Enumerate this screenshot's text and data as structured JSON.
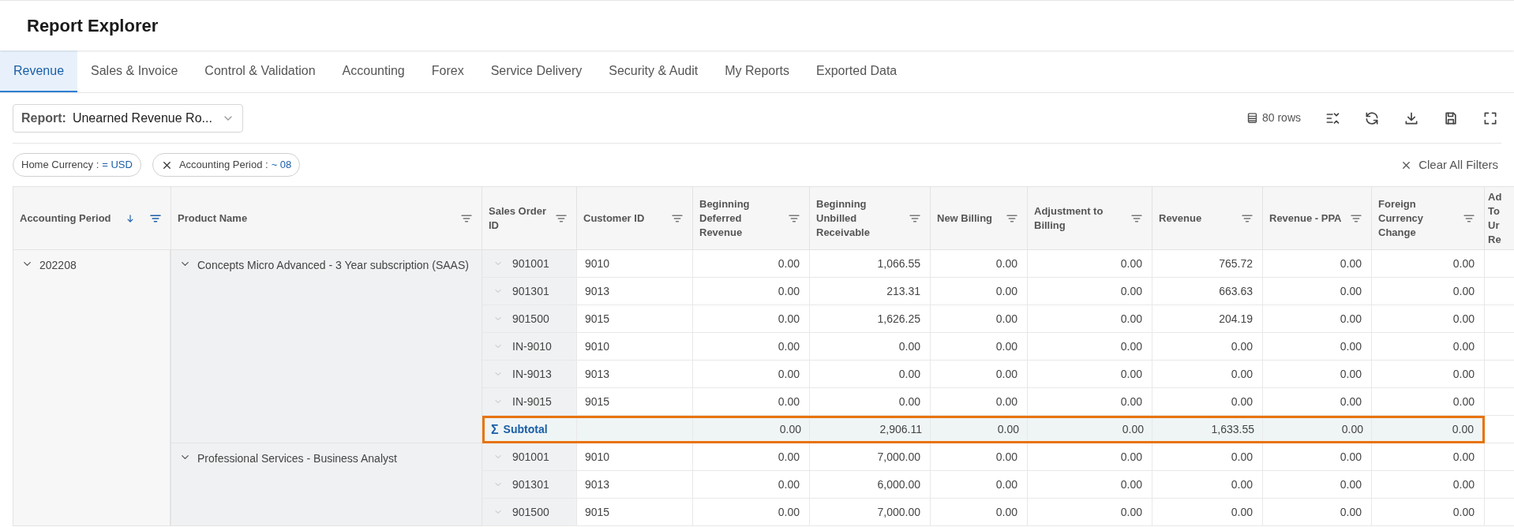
{
  "window": {
    "title": "Report Explorer"
  },
  "tabs": [
    {
      "label": "Revenue",
      "selected": true
    },
    {
      "label": "Sales & Invoice",
      "selected": false
    },
    {
      "label": "Control & Validation",
      "selected": false
    },
    {
      "label": "Accounting",
      "selected": false
    },
    {
      "label": "Forex",
      "selected": false
    },
    {
      "label": "Service Delivery",
      "selected": false
    },
    {
      "label": "Security & Audit",
      "selected": false
    },
    {
      "label": "My Reports",
      "selected": false
    },
    {
      "label": "Exported Data",
      "selected": false
    }
  ],
  "toolbar": {
    "report_label": "Report:",
    "report_value": "Unearned Revenue Ro...",
    "row_count": "80 rows"
  },
  "filters": [
    {
      "field": "Home Currency :",
      "value": "= USD",
      "removable": false
    },
    {
      "field": "Accounting Period :",
      "value": "~ 08",
      "removable": true
    }
  ],
  "clear_filters": "Clear All Filters",
  "table": {
    "columns": [
      {
        "label": "Accounting Period",
        "sorted": true,
        "filter_active": true
      },
      {
        "label": "Product Name",
        "sorted": false,
        "filter_active": false
      },
      {
        "label": "Sales Order ID",
        "sorted": false,
        "filter_active": false
      },
      {
        "label": "Customer ID",
        "sorted": false,
        "filter_active": false
      },
      {
        "label": "Beginning Deferred Revenue",
        "sorted": false,
        "filter_active": false
      },
      {
        "label": "Beginning Unbilled Receivable",
        "sorted": false,
        "filter_active": false
      },
      {
        "label": "New Billing",
        "sorted": false,
        "filter_active": false
      },
      {
        "label": "Adjustment to Billing",
        "sorted": false,
        "filter_active": false
      },
      {
        "label": "Revenue",
        "sorted": false,
        "filter_active": false
      },
      {
        "label": "Revenue - PPA",
        "sorted": false,
        "filter_active": false
      },
      {
        "label": "Foreign Currency Change",
        "sorted": false,
        "filter_active": false
      },
      {
        "label": "Ad To Ur Re"
      }
    ],
    "groups": [
      {
        "period": "202208",
        "expanded": true,
        "products": [
          {
            "name": "Concepts Micro Advanced - 3 Year subscription (SAAS)",
            "expanded": true,
            "rows": [
              {
                "order": "901001",
                "customer": "9010",
                "values": [
                  "0.00",
                  "1,066.55",
                  "0.00",
                  "0.00",
                  "765.72",
                  "0.00",
                  "0.00"
                ]
              },
              {
                "order": "901301",
                "customer": "9013",
                "values": [
                  "0.00",
                  "213.31",
                  "0.00",
                  "0.00",
                  "663.63",
                  "0.00",
                  "0.00"
                ]
              },
              {
                "order": "901500",
                "customer": "9015",
                "values": [
                  "0.00",
                  "1,626.25",
                  "0.00",
                  "0.00",
                  "204.19",
                  "0.00",
                  "0.00"
                ]
              },
              {
                "order": "IN-9010",
                "customer": "9010",
                "values": [
                  "0.00",
                  "0.00",
                  "0.00",
                  "0.00",
                  "0.00",
                  "0.00",
                  "0.00"
                ]
              },
              {
                "order": "IN-9013",
                "customer": "9013",
                "values": [
                  "0.00",
                  "0.00",
                  "0.00",
                  "0.00",
                  "0.00",
                  "0.00",
                  "0.00"
                ]
              },
              {
                "order": "IN-9015",
                "customer": "9015",
                "values": [
                  "0.00",
                  "0.00",
                  "0.00",
                  "0.00",
                  "0.00",
                  "0.00",
                  "0.00"
                ]
              }
            ],
            "subtotal": {
              "symbol": "Σ",
              "label": "Subtotal",
              "highlighted": true,
              "values": [
                "0.00",
                "2,906.11",
                "0.00",
                "0.00",
                "1,633.55",
                "0.00",
                "0.00"
              ]
            }
          },
          {
            "name": "Professional Services - Business Analyst",
            "expanded": true,
            "rows": [
              {
                "order": "901001",
                "customer": "9010",
                "values": [
                  "0.00",
                  "7,000.00",
                  "0.00",
                  "0.00",
                  "0.00",
                  "0.00",
                  "0.00"
                ]
              },
              {
                "order": "901301",
                "customer": "9013",
                "values": [
                  "0.00",
                  "6,000.00",
                  "0.00",
                  "0.00",
                  "0.00",
                  "0.00",
                  "0.00"
                ]
              },
              {
                "order": "901500",
                "customer": "9015",
                "values": [
                  "0.00",
                  "7,000.00",
                  "0.00",
                  "0.00",
                  "0.00",
                  "0.00",
                  "0.00"
                ]
              }
            ]
          }
        ]
      }
    ]
  }
}
